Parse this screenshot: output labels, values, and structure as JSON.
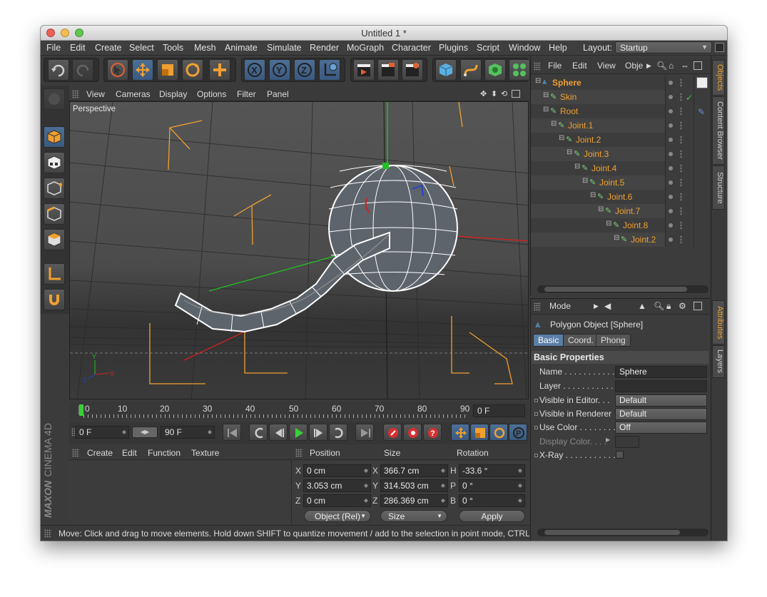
{
  "window": {
    "title": "Untitled 1 *"
  },
  "menu": [
    "File",
    "Edit",
    "Create",
    "Select",
    "Tools",
    "Mesh",
    "Animate",
    "Simulate",
    "Render",
    "MoGraph",
    "Character",
    "Plugins",
    "Script",
    "Window",
    "Help"
  ],
  "layout": {
    "label": "Layout:",
    "value": "Startup"
  },
  "viewport": {
    "menu": [
      "View",
      "Cameras",
      "Display",
      "Options",
      "Filter",
      "Panel"
    ],
    "label": "Perspective"
  },
  "timeline": {
    "ticks": [
      "0",
      "10",
      "20",
      "30",
      "40",
      "50",
      "60",
      "70",
      "80",
      "90"
    ],
    "current_frame": "0 F",
    "start_frame": "0 F",
    "end_frame": "90 F"
  },
  "materials": {
    "menu": [
      "Create",
      "Edit",
      "Function",
      "Texture"
    ]
  },
  "coords": {
    "headers": [
      "Position",
      "Size",
      "Rotation"
    ],
    "pos": [
      {
        "axis": "X",
        "value": "0 cm"
      },
      {
        "axis": "Y",
        "value": "3.053 cm"
      },
      {
        "axis": "Z",
        "value": "0 cm"
      }
    ],
    "size": [
      {
        "axis": "X",
        "value": "366.7 cm"
      },
      {
        "axis": "Y",
        "value": "314.503 cm"
      },
      {
        "axis": "Z",
        "value": "286.369 cm"
      }
    ],
    "rot": [
      {
        "axis": "H",
        "value": "-33.6 °"
      },
      {
        "axis": "P",
        "value": "0 °"
      },
      {
        "axis": "B",
        "value": "0 °"
      }
    ],
    "mode": "Object (Rel)",
    "size_mode": "Size",
    "apply": "Apply"
  },
  "objects": {
    "menu": [
      "File",
      "Edit",
      "View",
      "Obje"
    ],
    "items": [
      {
        "name": "Sphere",
        "depth": 0
      },
      {
        "name": "Skin",
        "depth": 1
      },
      {
        "name": "Root",
        "depth": 1
      },
      {
        "name": "Joint.1",
        "depth": 2
      },
      {
        "name": "Joint.2",
        "depth": 3
      },
      {
        "name": "Joint.3",
        "depth": 4
      },
      {
        "name": "Joint.4",
        "depth": 5
      },
      {
        "name": "Joint.5",
        "depth": 6
      },
      {
        "name": "Joint.6",
        "depth": 7
      },
      {
        "name": "Joint.7",
        "depth": 8
      },
      {
        "name": "Joint.8",
        "depth": 9
      },
      {
        "name": "Joint.2",
        "depth": 10
      }
    ]
  },
  "side_tabs_top": [
    "Objects",
    "Content Browser",
    "Structure"
  ],
  "side_tabs_bottom": [
    "Attributes",
    "Layers"
  ],
  "attributes": {
    "mode": "Mode",
    "object_title": "Polygon Object [Sphere]",
    "tabs": [
      "Basic",
      "Coord.",
      "Phong"
    ],
    "section": "Basic Properties",
    "props": [
      {
        "label": "Name . . . . . . . . . . .",
        "value": "Sphere"
      },
      {
        "label": "Layer . . . . . . . . . . .",
        "value": ""
      },
      {
        "label": "Visible in Editor. . .",
        "value": "Default"
      },
      {
        "label": "Visible in Renderer",
        "value": "Default"
      },
      {
        "label": "Use Color . . . . . . . .",
        "value": "Off"
      },
      {
        "label": "Display Color. . . .",
        "value": ""
      },
      {
        "label": "X-Ray . . . . . . . . . . .",
        "value": ""
      }
    ]
  },
  "brand": {
    "maxon": "MAXON",
    "product": "CINEMA 4D"
  },
  "status": "Move: Click and drag to move elements. Hold down SHIFT to quantize movement / add to the selection in point mode, CTRL to remove.",
  "colors": {
    "accent": "#f0a030",
    "highlight": "#5b7ea6",
    "bg": "#3b3b3b"
  }
}
